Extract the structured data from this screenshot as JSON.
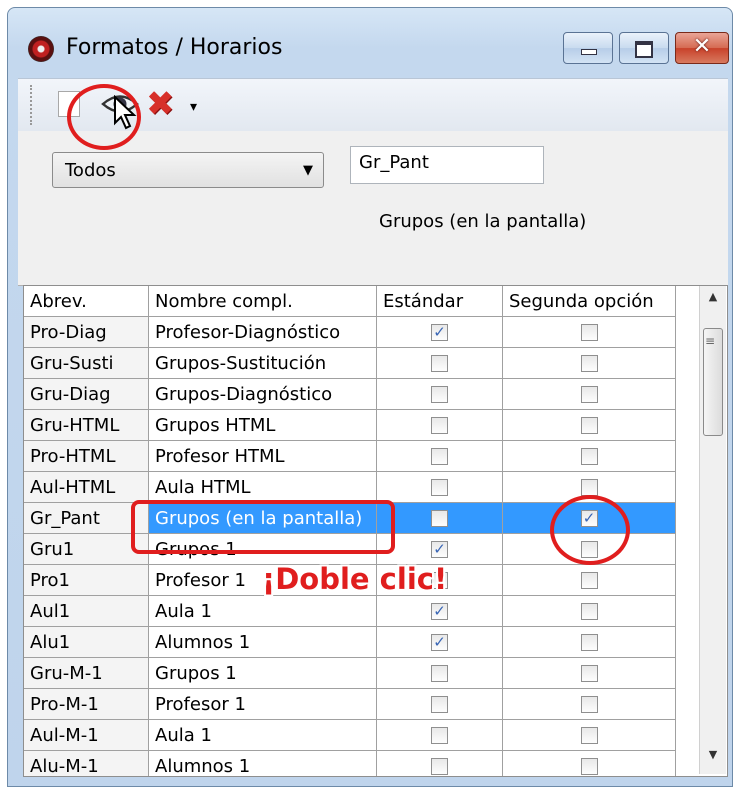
{
  "window": {
    "title": "Formatos / Horarios",
    "close_glyph": "✕"
  },
  "toolbar": {
    "icons": [
      "new-icon",
      "eye-icon",
      "delete-icon"
    ],
    "dropdown_arrow": "▾"
  },
  "filter": {
    "selected": "Todos",
    "arrow": "▼"
  },
  "code_field": {
    "value": "Gr_Pant"
  },
  "description": "Grupos (en la pantalla)",
  "table": {
    "headers": [
      "Abrev.",
      "Nombre compl.",
      "Estándar",
      "Segunda opción"
    ],
    "rows": [
      {
        "abbr": "Pro-Diag",
        "name": "Profesor-Diagnóstico",
        "standard": true,
        "second": false
      },
      {
        "abbr": "Gru-Susti",
        "name": "Grupos-Sustitución",
        "standard": false,
        "second": false
      },
      {
        "abbr": "Gru-Diag",
        "name": "Grupos-Diagnóstico",
        "standard": false,
        "second": false
      },
      {
        "abbr": "Gru-HTML",
        "name": "Grupos HTML",
        "standard": false,
        "second": false
      },
      {
        "abbr": "Pro-HTML",
        "name": "Profesor HTML",
        "standard": false,
        "second": false
      },
      {
        "abbr": "Aul-HTML",
        "name": "Aula HTML",
        "standard": false,
        "second": false
      },
      {
        "abbr": "Gr_Pant",
        "name": "Grupos (en la pantalla)",
        "standard": false,
        "second": true,
        "selected": true
      },
      {
        "abbr": "Gru1",
        "name": "Grupos 1",
        "standard": true,
        "second": false
      },
      {
        "abbr": "Pro1",
        "name": "Profesor 1",
        "standard": false,
        "second": false
      },
      {
        "abbr": "Aul1",
        "name": "Aula 1",
        "standard": true,
        "second": false
      },
      {
        "abbr": "Alu1",
        "name": "Alumnos 1",
        "standard": true,
        "second": false
      },
      {
        "abbr": "Gru-M-1",
        "name": "Grupos 1",
        "standard": false,
        "second": false
      },
      {
        "abbr": "Pro-M-1",
        "name": "Profesor 1",
        "standard": false,
        "second": false
      },
      {
        "abbr": "Aul-M-1",
        "name": "Aula 1",
        "standard": false,
        "second": false
      },
      {
        "abbr": "Alu-M-1",
        "name": "Alumnos 1",
        "standard": false,
        "second": false
      }
    ]
  },
  "annotation": {
    "text": "¡Doble clic!",
    "color": "#e01e1e"
  },
  "colors": {
    "selection": "#3399ff",
    "check": "#3a66b5"
  }
}
